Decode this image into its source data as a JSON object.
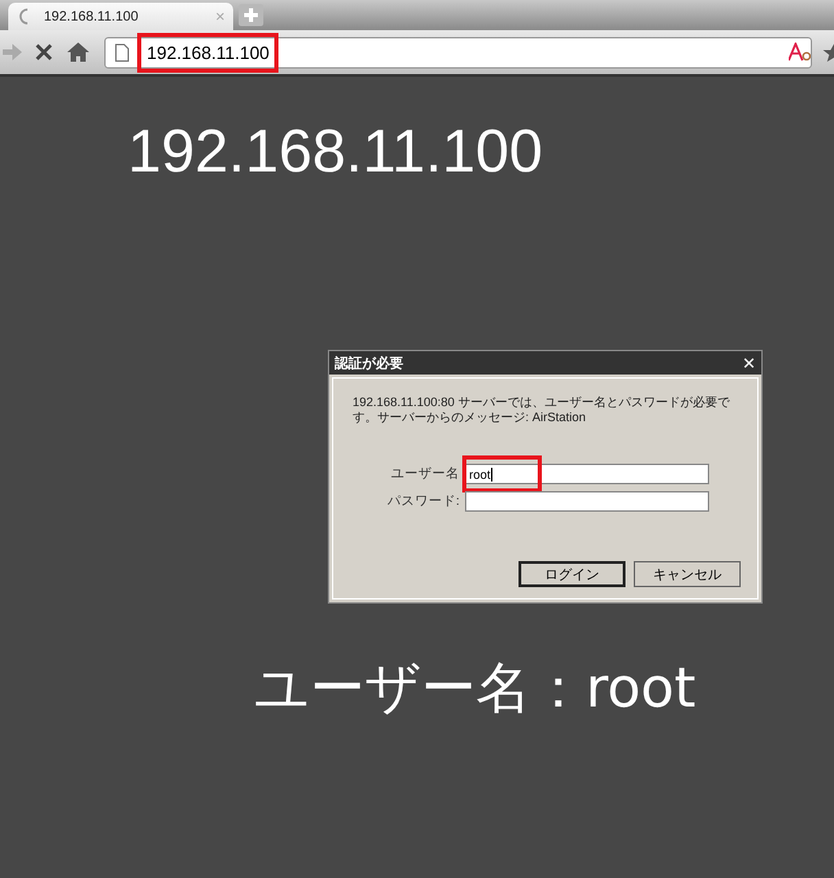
{
  "tab": {
    "title": "192.168.11.100",
    "close": "×"
  },
  "toolbar": {
    "url": "192.168.11.100",
    "highlighted": true
  },
  "page": {
    "heading": "192.168.11.100",
    "caption": "ユーザー名：root"
  },
  "dialog": {
    "title": "認証が必要",
    "close": "✕",
    "message": "192.168.11.100:80 サーバーでは、ユーザー名とパスワードが必要です。サーバーからのメッセージ: AirStation",
    "fields": [
      {
        "label": "ユーザー名",
        "value": "root",
        "highlighted": true
      },
      {
        "label": "パスワード:",
        "highlighted": false
      }
    ],
    "buttons": [
      {
        "label": "ログイン",
        "selected": true
      },
      {
        "label": "キャンセル",
        "selected": false
      }
    ]
  }
}
